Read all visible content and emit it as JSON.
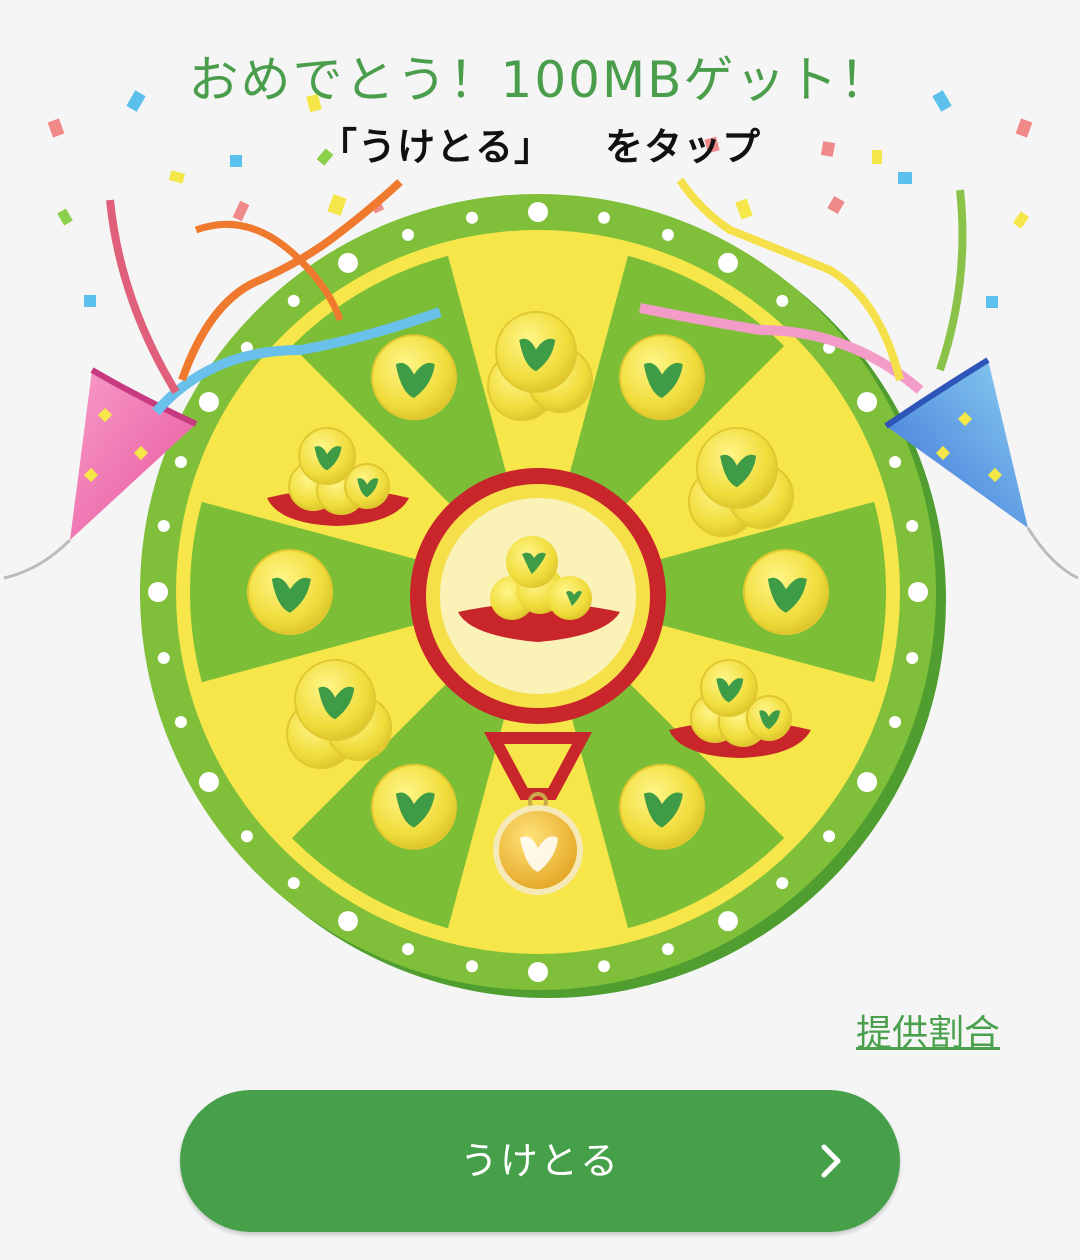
{
  "header": {
    "headline": "おめでとう！100MBゲット！",
    "instruction_quote": "「うけとる」",
    "instruction_action": "をタップ"
  },
  "wheel": {
    "segments_total": 12,
    "colors": {
      "rim": "#7fbf3a",
      "yellow": "#f7e64a",
      "green": "#7cbf37",
      "hub_ring": "#c8262a",
      "coin": "#f2e14a",
      "leaf": "#3e9c46"
    },
    "prize_icons": [
      "coin-stack-icon",
      "coin-icon",
      "coin-stack-icon",
      "coin-icon",
      "coin-pile-cushion-icon",
      "coin-icon",
      "medal-icon",
      "coin-icon",
      "coin-stack-icon",
      "coin-icon",
      "coin-pile-cushion-icon",
      "coin-icon"
    ],
    "center_prize_icon": "coin-pile-cushion-icon"
  },
  "decorations": {
    "left_popper_icon": "party-popper-icon",
    "right_popper_icon": "party-popper-icon"
  },
  "links": {
    "prize_rates": "提供割合"
  },
  "actions": {
    "claim_label": "うけとる",
    "claim_icon": "chevron-right-icon",
    "button_color": "#46a049"
  }
}
